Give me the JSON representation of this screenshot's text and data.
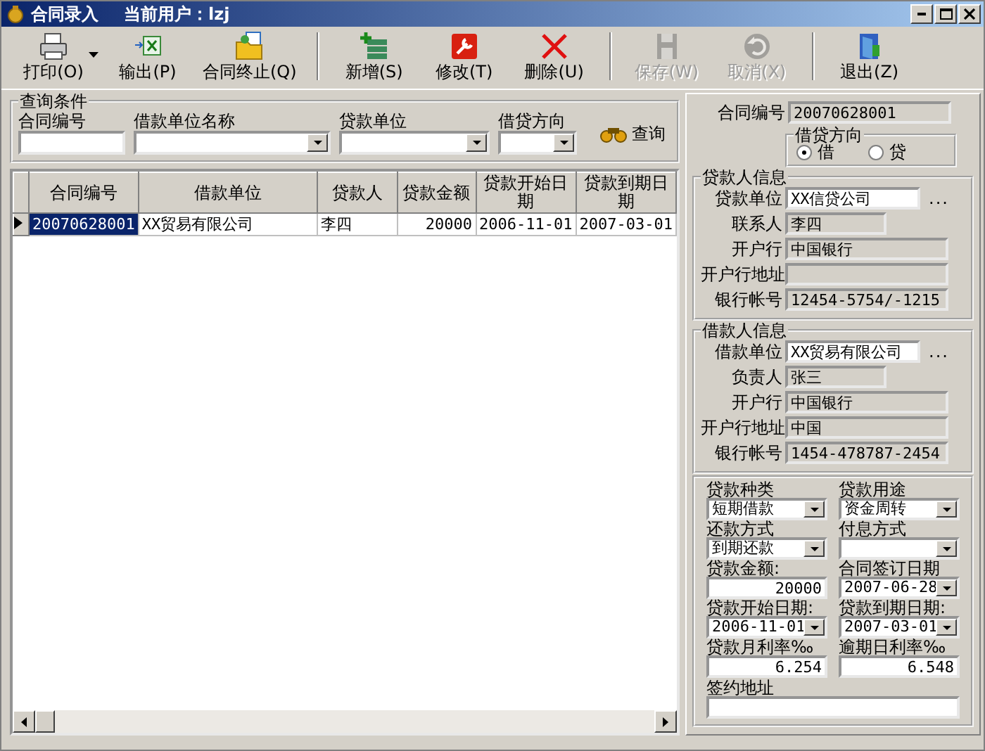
{
  "window": {
    "title": "合同录入",
    "user": "当前用户：lzj"
  },
  "toolbar": [
    [
      {
        "label": "打印(O)",
        "disabled": false,
        "menu": true
      },
      {
        "label": "输出(P)",
        "disabled": false,
        "menu": false
      },
      {
        "label": "合同终止(Q)",
        "disabled": false,
        "menu": false
      }
    ],
    [
      {
        "label": "新增(S)",
        "disabled": false,
        "menu": false
      },
      {
        "label": "修改(T)",
        "disabled": false,
        "menu": false
      },
      {
        "label": "删除(U)",
        "disabled": false,
        "menu": false
      }
    ],
    [
      {
        "label": "保存(W)",
        "disabled": true,
        "menu": false
      },
      {
        "label": "取消(X)",
        "disabled": true,
        "menu": false
      }
    ],
    [
      {
        "label": "退出(Z)",
        "disabled": false,
        "menu": false
      }
    ]
  ],
  "query": {
    "title": "查询条件",
    "fields": [
      {
        "label": "合同编号",
        "kind": "text"
      },
      {
        "label": "借款单位名称",
        "kind": "combo"
      },
      {
        "label": "贷款单位",
        "kind": "combo"
      },
      {
        "label": "借贷方向",
        "kind": "combo"
      }
    ],
    "button": "查询"
  },
  "grid": {
    "columns": [
      "合同编号",
      "借款单位",
      "贷款人",
      "贷款金额",
      "贷款开始日期",
      "贷款到期日期"
    ],
    "rows": [
      {
        "selected": true,
        "cells": [
          "20070628001",
          "XX贸易有限公司",
          "李四",
          "20000",
          "2006-11-01",
          "2007-03-01"
        ]
      }
    ]
  },
  "contract": {
    "label": "合同编号",
    "value": "20070628001"
  },
  "direction": {
    "title": "借贷方向",
    "options": [
      {
        "label": "借",
        "selected": true
      },
      {
        "label": "贷",
        "selected": false
      }
    ]
  },
  "lender": {
    "title": "贷款人信息",
    "fields": [
      {
        "label": "贷款单位",
        "value": "XX信贷公司",
        "kind": "lookup",
        "button": "..."
      },
      {
        "label": "联系人",
        "value": "李四",
        "kind": "short"
      },
      {
        "label": "开户行",
        "value": "中国银行",
        "kind": "long"
      },
      {
        "label": "开户行地址",
        "kind": "long"
      },
      {
        "label": "银行帐号",
        "value": "12454-5754/-1215",
        "kind": "long"
      }
    ]
  },
  "borrower": {
    "title": "借款人信息",
    "fields": [
      {
        "label": "借款单位",
        "value": "XX贸易有限公司",
        "kind": "lookup",
        "button": "..."
      },
      {
        "label": "负责人",
        "value": "张三",
        "kind": "short"
      },
      {
        "label": "开户行",
        "value": "中国银行",
        "kind": "long"
      },
      {
        "label": "开户行地址",
        "value": "中国",
        "kind": "long"
      },
      {
        "label": "银行帐号",
        "value": "1454-478787-2454",
        "kind": "long"
      }
    ]
  },
  "terms": [
    {
      "label": "贷款种类",
      "kind": "combo",
      "value": "短期借款"
    },
    {
      "label": "贷款用途",
      "kind": "combo",
      "value": "资金周转"
    },
    {
      "label": "还款方式",
      "kind": "combo",
      "value": "到期还款"
    },
    {
      "label": "付息方式",
      "kind": "combo"
    },
    {
      "label": "贷款金额:",
      "kind": "amount",
      "value": "20000"
    },
    {
      "label": "合同签订日期",
      "kind": "combo",
      "value": "2007-06-28"
    },
    {
      "label": "贷款开始日期:",
      "kind": "combo",
      "value": "2006-11-01"
    },
    {
      "label": "贷款到期日期:",
      "kind": "combo",
      "value": "2007-03-01"
    },
    {
      "label": "贷款月利率‰",
      "kind": "amount",
      "value": "6.254"
    },
    {
      "label": "逾期日利率‰",
      "kind": "amount",
      "value": "6.548"
    },
    {
      "label": "签约地址",
      "kind": "text"
    }
  ]
}
